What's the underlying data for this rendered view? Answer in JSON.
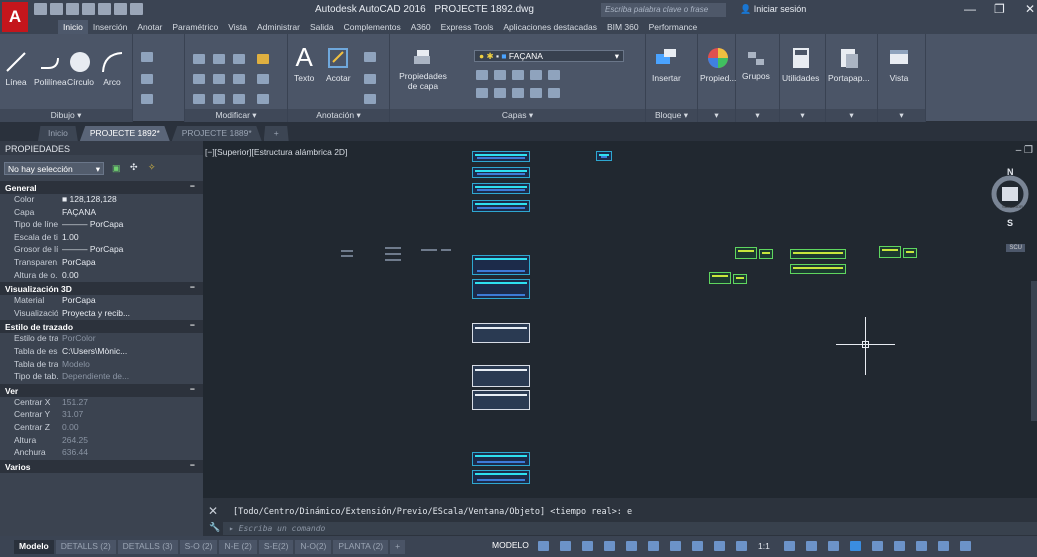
{
  "app": {
    "logo_letter": "A",
    "title_app": "Autodesk AutoCAD 2016",
    "title_file": "PROJECTE 1892.dwg",
    "search_placeholder": "Escriba palabra clave o frase",
    "signin": "Iniciar sesión"
  },
  "ribbon_tabs": [
    "Inicio",
    "Inserción",
    "Anotar",
    "Paramétrico",
    "Vista",
    "Administrar",
    "Salida",
    "Complementos",
    "A360",
    "Express Tools",
    "Aplicaciones destacadas",
    "BIM 360",
    "Performance"
  ],
  "ribbon": {
    "draw": {
      "title": "Dibujo ▾",
      "line": "Línea",
      "polyline": "Polilínea",
      "circle": "Círculo",
      "arc": "Arco"
    },
    "modify": {
      "title": "Modificar ▾"
    },
    "annotation": {
      "title": "Anotación ▾",
      "text": "Texto",
      "dimension": "Acotar"
    },
    "layers": {
      "title": "Capas ▾",
      "props": "Propiedades de capa",
      "current_layer": "FAÇANA"
    },
    "block": {
      "title": "Bloque ▾",
      "insert": "Insertar"
    },
    "properties": {
      "label": "Propied..."
    },
    "groups": {
      "label": "Grupos"
    },
    "utilities": {
      "label": "Utilidades"
    },
    "clipboard": {
      "label": "Portapap..."
    },
    "view": {
      "label": "Vista"
    }
  },
  "doc_tabs": [
    {
      "label": "Inicio"
    },
    {
      "label": "PROJECTE 1892*"
    },
    {
      "label": "PROJECTE 1889*"
    },
    {
      "label": "+"
    }
  ],
  "properties": {
    "header": "PROPIEDADES",
    "selection": "No hay selección",
    "sections": [
      {
        "title": "General",
        "rows": [
          {
            "k": "Color",
            "v": "■ 128,128,128"
          },
          {
            "k": "Capa",
            "v": "FAÇANA"
          },
          {
            "k": "Tipo de línea",
            "v": "——— PorCapa"
          },
          {
            "k": "Escala de ti...",
            "v": "1.00"
          },
          {
            "k": "Grosor de lí...",
            "v": "——— PorCapa"
          },
          {
            "k": "Transparen...",
            "v": "PorCapa"
          },
          {
            "k": "Altura de o...",
            "v": "0.00"
          }
        ]
      },
      {
        "title": "Visualización 3D",
        "rows": [
          {
            "k": "Material",
            "v": "PorCapa"
          },
          {
            "k": "Visualizació...",
            "v": "Proyecta y recib..."
          }
        ]
      },
      {
        "title": "Estilo de trazado",
        "rows": [
          {
            "k": "Estilo de tra...",
            "v": "PorColor"
          },
          {
            "k": "Tabla de es...",
            "v": "C:\\Users\\Mònic..."
          },
          {
            "k": "Tabla de tra...",
            "v": "Modelo"
          },
          {
            "k": "Tipo de tab...",
            "v": "Dependiente de..."
          }
        ]
      },
      {
        "title": "Ver",
        "rows": [
          {
            "k": "Centrar X",
            "v": "151.27"
          },
          {
            "k": "Centrar Y",
            "v": "31.07"
          },
          {
            "k": "Centrar Z",
            "v": "0.00"
          },
          {
            "k": "Altura",
            "v": "264.25"
          },
          {
            "k": "Anchura",
            "v": "636.44"
          }
        ]
      },
      {
        "title": "Varios",
        "rows": []
      }
    ]
  },
  "viewport": {
    "label": "[−][Superior][Estructura alámbrica 2D]",
    "viewcube_n": "N",
    "viewcube_s": "S",
    "viewcube_face": "SUPERIOR",
    "ucs": "SCU"
  },
  "command": {
    "history": "[Todo/Centro/Dinámico/Extensión/Previo/EScala/Ventana/Objeto] <tiempo real>: e",
    "placeholder": "Escriba un comando"
  },
  "layout_tabs": [
    "Modelo",
    "DETALLS (2)",
    "DETALLS (3)",
    "S-O (2)",
    "N-E (2)",
    "S-E(2)",
    "N-O(2)",
    "PLANTA (2)",
    "+"
  ],
  "status": {
    "model": "MODELO",
    "scale": "1:1"
  }
}
